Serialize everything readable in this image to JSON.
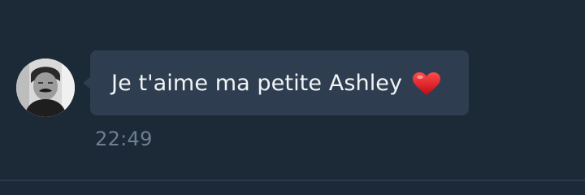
{
  "message": {
    "text": "Je t'aime ma petite Ashley",
    "emoji_icon": "red-heart-icon",
    "timestamp": "22:49"
  },
  "colors": {
    "background": "#1c2937",
    "bubble": "#2e3e50",
    "message_text": "#f2f4f6",
    "timestamp_text": "#6e7f91",
    "heart": "#d8111b"
  }
}
